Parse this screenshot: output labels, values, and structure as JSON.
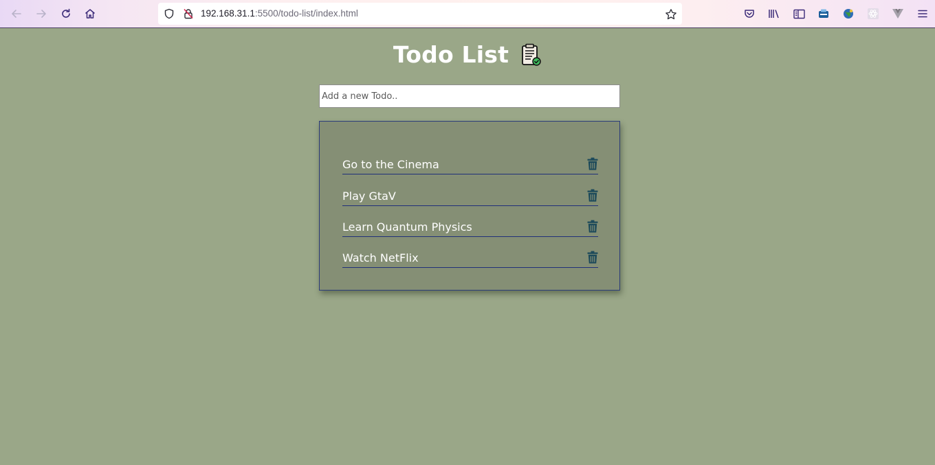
{
  "browser": {
    "url_host": "192.168.31.1",
    "url_rest": ":5500/todo-list/index.html",
    "icons": [
      "back-arrow-icon",
      "forward-arrow-icon",
      "reload-icon",
      "home-icon",
      "shield-icon",
      "insecure-lock-icon",
      "star-icon",
      "pocket-icon",
      "library-icon",
      "sidebar-icon",
      "extension-box-icon",
      "extension-globe-icon",
      "extension-react-icon",
      "extension-vue-icon",
      "menu-icon"
    ]
  },
  "app": {
    "title": "Todo List",
    "title_icon": "clipboard-check-icon",
    "input_placeholder": "Add a new Todo.."
  },
  "todos": [
    {
      "label": "Go to the Cinema"
    },
    {
      "label": "Play GtaV"
    },
    {
      "label": "Learn Quantum Physics"
    },
    {
      "label": "Watch NetFlix"
    }
  ],
  "colors": {
    "page_background": "#9aa788",
    "panel_background": "#858f75",
    "panel_border": "#2b3c7a",
    "trash_icon": "#1d4a5a",
    "text": "#ffffff"
  }
}
